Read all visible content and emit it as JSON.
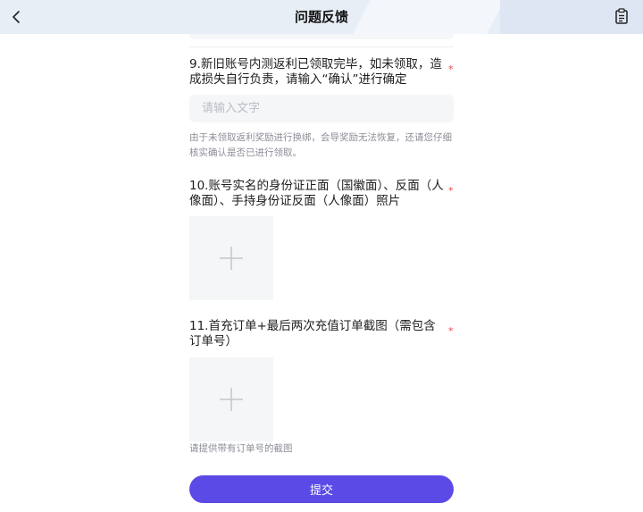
{
  "header": {
    "title": "问题反馈",
    "back_icon": "chevron-left-icon",
    "right_icon": "clipboard-icon"
  },
  "questions": [
    {
      "text": "9.新旧账号内测返利已领取完毕，如未领取，造成损失自行负责，请输入“确认”进行确定",
      "required_mark": "*",
      "input_placeholder": "请输入文字",
      "input_value": "",
      "hint": "由于未领取返利奖励进行换绑，会导奖励无法恢复，还请您仔细核实确认是否已进行领取。"
    },
    {
      "text": "10.账号实名的身份证正面（国徽面）、反面（人像面）、手持身份证反面（人像面）照片",
      "required_mark": "*",
      "upload_icon": "plus-icon"
    },
    {
      "text": "11.首充订单+最后两次充值订单截图（需包含订单号）",
      "required_mark": "*",
      "upload_icon": "plus-icon",
      "hint": "请提供带有订单号的截图"
    }
  ],
  "submit_label": "提交",
  "colors": {
    "accent": "#5b4ae6",
    "required": "#e04b4b",
    "header_bg": "#e8eef6",
    "field_bg": "#f5f6f8"
  }
}
